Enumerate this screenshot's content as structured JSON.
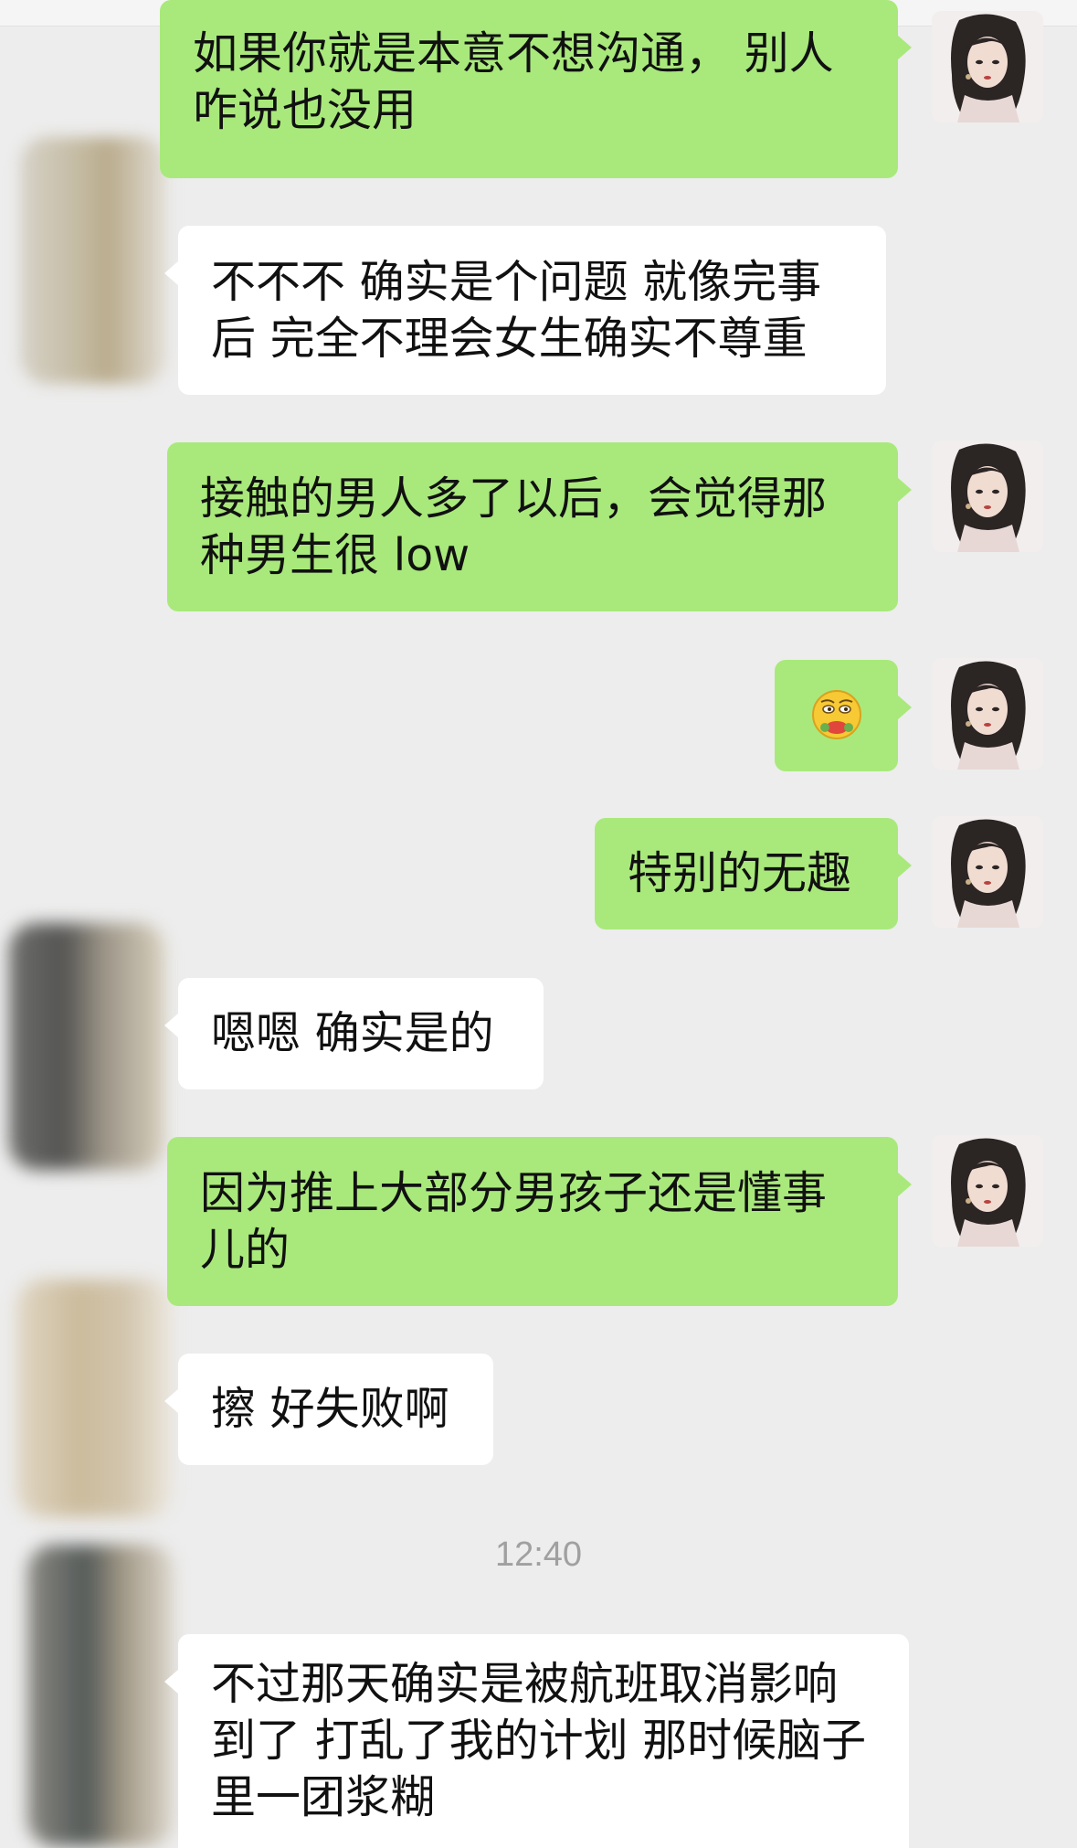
{
  "chat": {
    "timestamp": "12:40",
    "messages": [
      {
        "from": "me",
        "text": "如果你就是本意不想沟通， 别人咋说也没用"
      },
      {
        "from": "them",
        "text": "不不不 确实是个问题 就像完事后 完全不理会女生确实不尊重"
      },
      {
        "from": "me",
        "text": "接触的男人多了以后，会觉得那种男生很 low"
      },
      {
        "from": "me",
        "emoji": "pondering-face-emoji"
      },
      {
        "from": "me",
        "text": "特别的无趣"
      },
      {
        "from": "them",
        "text": "嗯嗯 确实是的"
      },
      {
        "from": "me",
        "text": "因为推上大部分男孩子还是懂事儿的"
      },
      {
        "from": "them",
        "text": "擦 好失败啊"
      },
      {
        "from": "them",
        "text": "不过那天确实是被航班取消影响到了 打乱了我的计划 那时候脑子里一团浆糊"
      }
    ]
  },
  "colors": {
    "background": "#ededed",
    "my_bubble": "#a9e97c",
    "their_bubble": "#ffffff",
    "timestamp": "#a0a0a0"
  }
}
